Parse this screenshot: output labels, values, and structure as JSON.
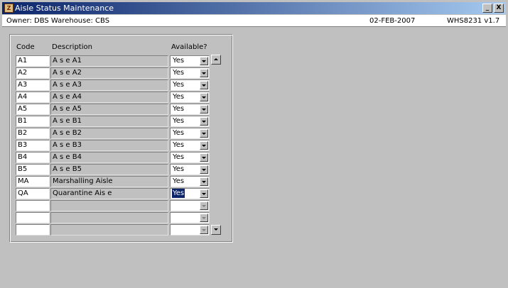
{
  "window": {
    "title": "Aisle Status Maintenance",
    "icon_glyph": "Z",
    "minimize_glyph": "_",
    "close_glyph": "X"
  },
  "info": {
    "owner": "Owner: DBS  Warehouse: CBS",
    "date": "02-FEB-2007",
    "version": "WHS8231  v1.7"
  },
  "headers": {
    "code": "Code",
    "description": "Description",
    "available": "Available?"
  },
  "rows": [
    {
      "code": "A1",
      "description": "A s e A1",
      "available": "Yes"
    },
    {
      "code": "A2",
      "description": "A s e A2",
      "available": "Yes"
    },
    {
      "code": "A3",
      "description": "A s e A3",
      "available": "Yes"
    },
    {
      "code": "A4",
      "description": "A s e A4",
      "available": "Yes"
    },
    {
      "code": "A5",
      "description": "A s e A5",
      "available": "Yes"
    },
    {
      "code": "B1",
      "description": "A s e B1",
      "available": "Yes"
    },
    {
      "code": "B2",
      "description": "A s e B2",
      "available": "Yes"
    },
    {
      "code": "B3",
      "description": "A s e B3",
      "available": "Yes"
    },
    {
      "code": "B4",
      "description": "A s e B4",
      "available": "Yes"
    },
    {
      "code": "B5",
      "description": "A s e B5",
      "available": "Yes"
    },
    {
      "code": "MA",
      "description": "Marshalling Aisle",
      "available": "Yes"
    },
    {
      "code": "QA",
      "description": "Quarantine Ais e",
      "available": "Yes"
    },
    {
      "code": "",
      "description": "",
      "available": ""
    },
    {
      "code": "",
      "description": "",
      "available": ""
    },
    {
      "code": "",
      "description": "",
      "available": ""
    }
  ],
  "selected_row": 11,
  "colors": {
    "title_active": "#0a246a",
    "selection": "#0a246a",
    "face": "#c0c0c0"
  }
}
